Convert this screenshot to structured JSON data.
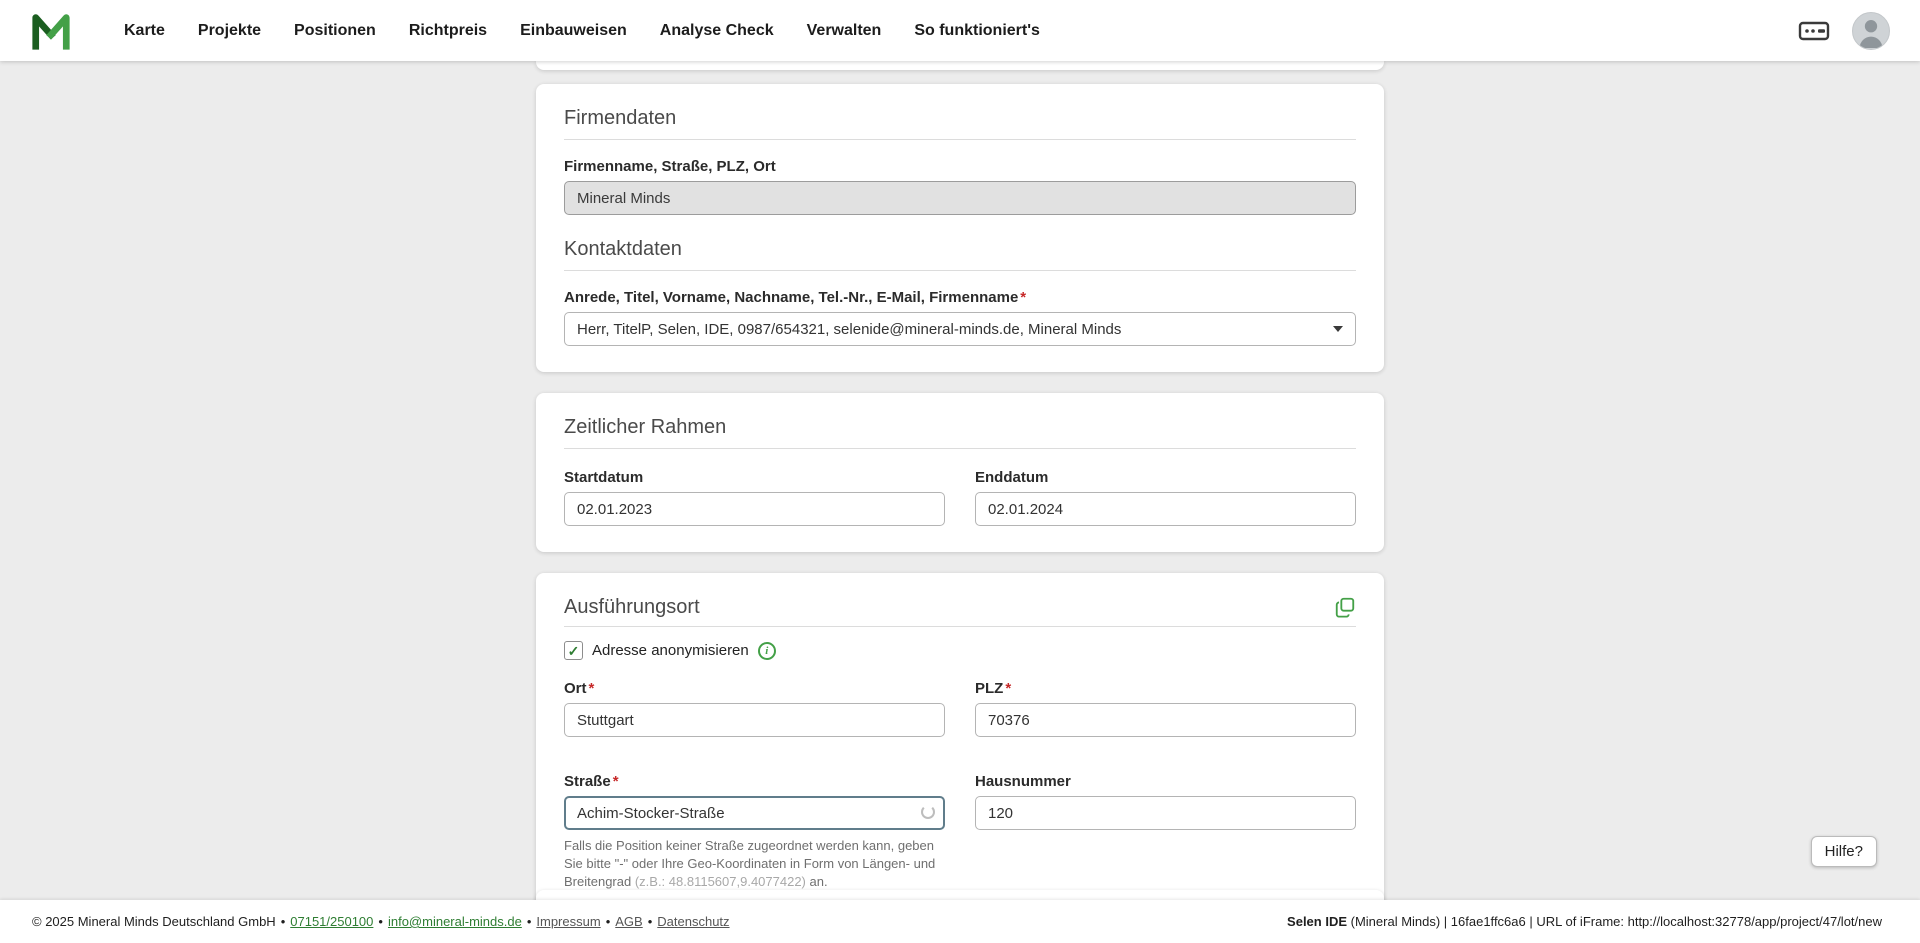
{
  "nav": {
    "items": [
      "Karte",
      "Projekte",
      "Positionen",
      "Richtpreis",
      "Einbauweisen",
      "Analyse Check",
      "Verwalten",
      "So funktioniert's"
    ]
  },
  "icons": {
    "logo": "mineral-minds-logo",
    "server": "server-icon",
    "avatar": "user-avatar-icon",
    "dropdown": "chevron-down-icon",
    "copy": "copy-icon",
    "info": "info-icon",
    "spinner": "loading-spinner-icon",
    "check_glyph": "✓",
    "info_glyph": "i"
  },
  "colors": {
    "accent_green": "#2e7d32",
    "focus_border": "#607d8b",
    "required_red": "#c62828"
  },
  "required_marker": "*",
  "cards": {
    "firmendaten": {
      "title": "Firmendaten",
      "company_label": "Firmenname, Straße, PLZ, Ort",
      "company_value": "Mineral Minds",
      "kontakt_title": "Kontaktdaten",
      "contact_label": "Anrede, Titel, Vorname, Nachname, Tel.-Nr., E-Mail, Firmenname",
      "contact_value": "Herr, TitelP, Selen, IDE, 0987/654321, selenide@mineral-minds.de, Mineral Minds"
    },
    "zeitraum": {
      "title": "Zeitlicher Rahmen",
      "start_label": "Startdatum",
      "start_value": "02.01.2023",
      "end_label": "Enddatum",
      "end_value": "02.01.2024"
    },
    "ort": {
      "title": "Ausführungsort",
      "anonymize_label": "Adresse anonymisieren",
      "ort_label": "Ort",
      "ort_value": "Stuttgart",
      "plz_label": "PLZ",
      "plz_value": "70376",
      "strasse_label": "Straße",
      "strasse_value": "Achim-Stocker-Straße",
      "hausnummer_label": "Hausnummer",
      "hausnummer_value": "120",
      "hint_part1": "Falls die Position keiner Straße zugeordnet werden kann, geben Sie bitte \"-\" oder Ihre Geo-Koordinaten in Form von Längen- und Breitengrad ",
      "hint_example": "(z.B.: 48.8115607,9.4077422)",
      "hint_part2": " an."
    }
  },
  "help": {
    "label": "Hilfe?"
  },
  "footer": {
    "copyright": "© 2025 Mineral Minds Deutschland GmbH",
    "separator": "•",
    "phone": "07151/250100",
    "email": "info@mineral-minds.de",
    "links": [
      "Impressum",
      "AGB",
      "Datenschutz"
    ],
    "right_bold": "Selen IDE",
    "right_rest": " (Mineral Minds) | 16fae1ffc6a6 | URL of iFrame: http://localhost:32778/app/project/47/lot/new"
  }
}
